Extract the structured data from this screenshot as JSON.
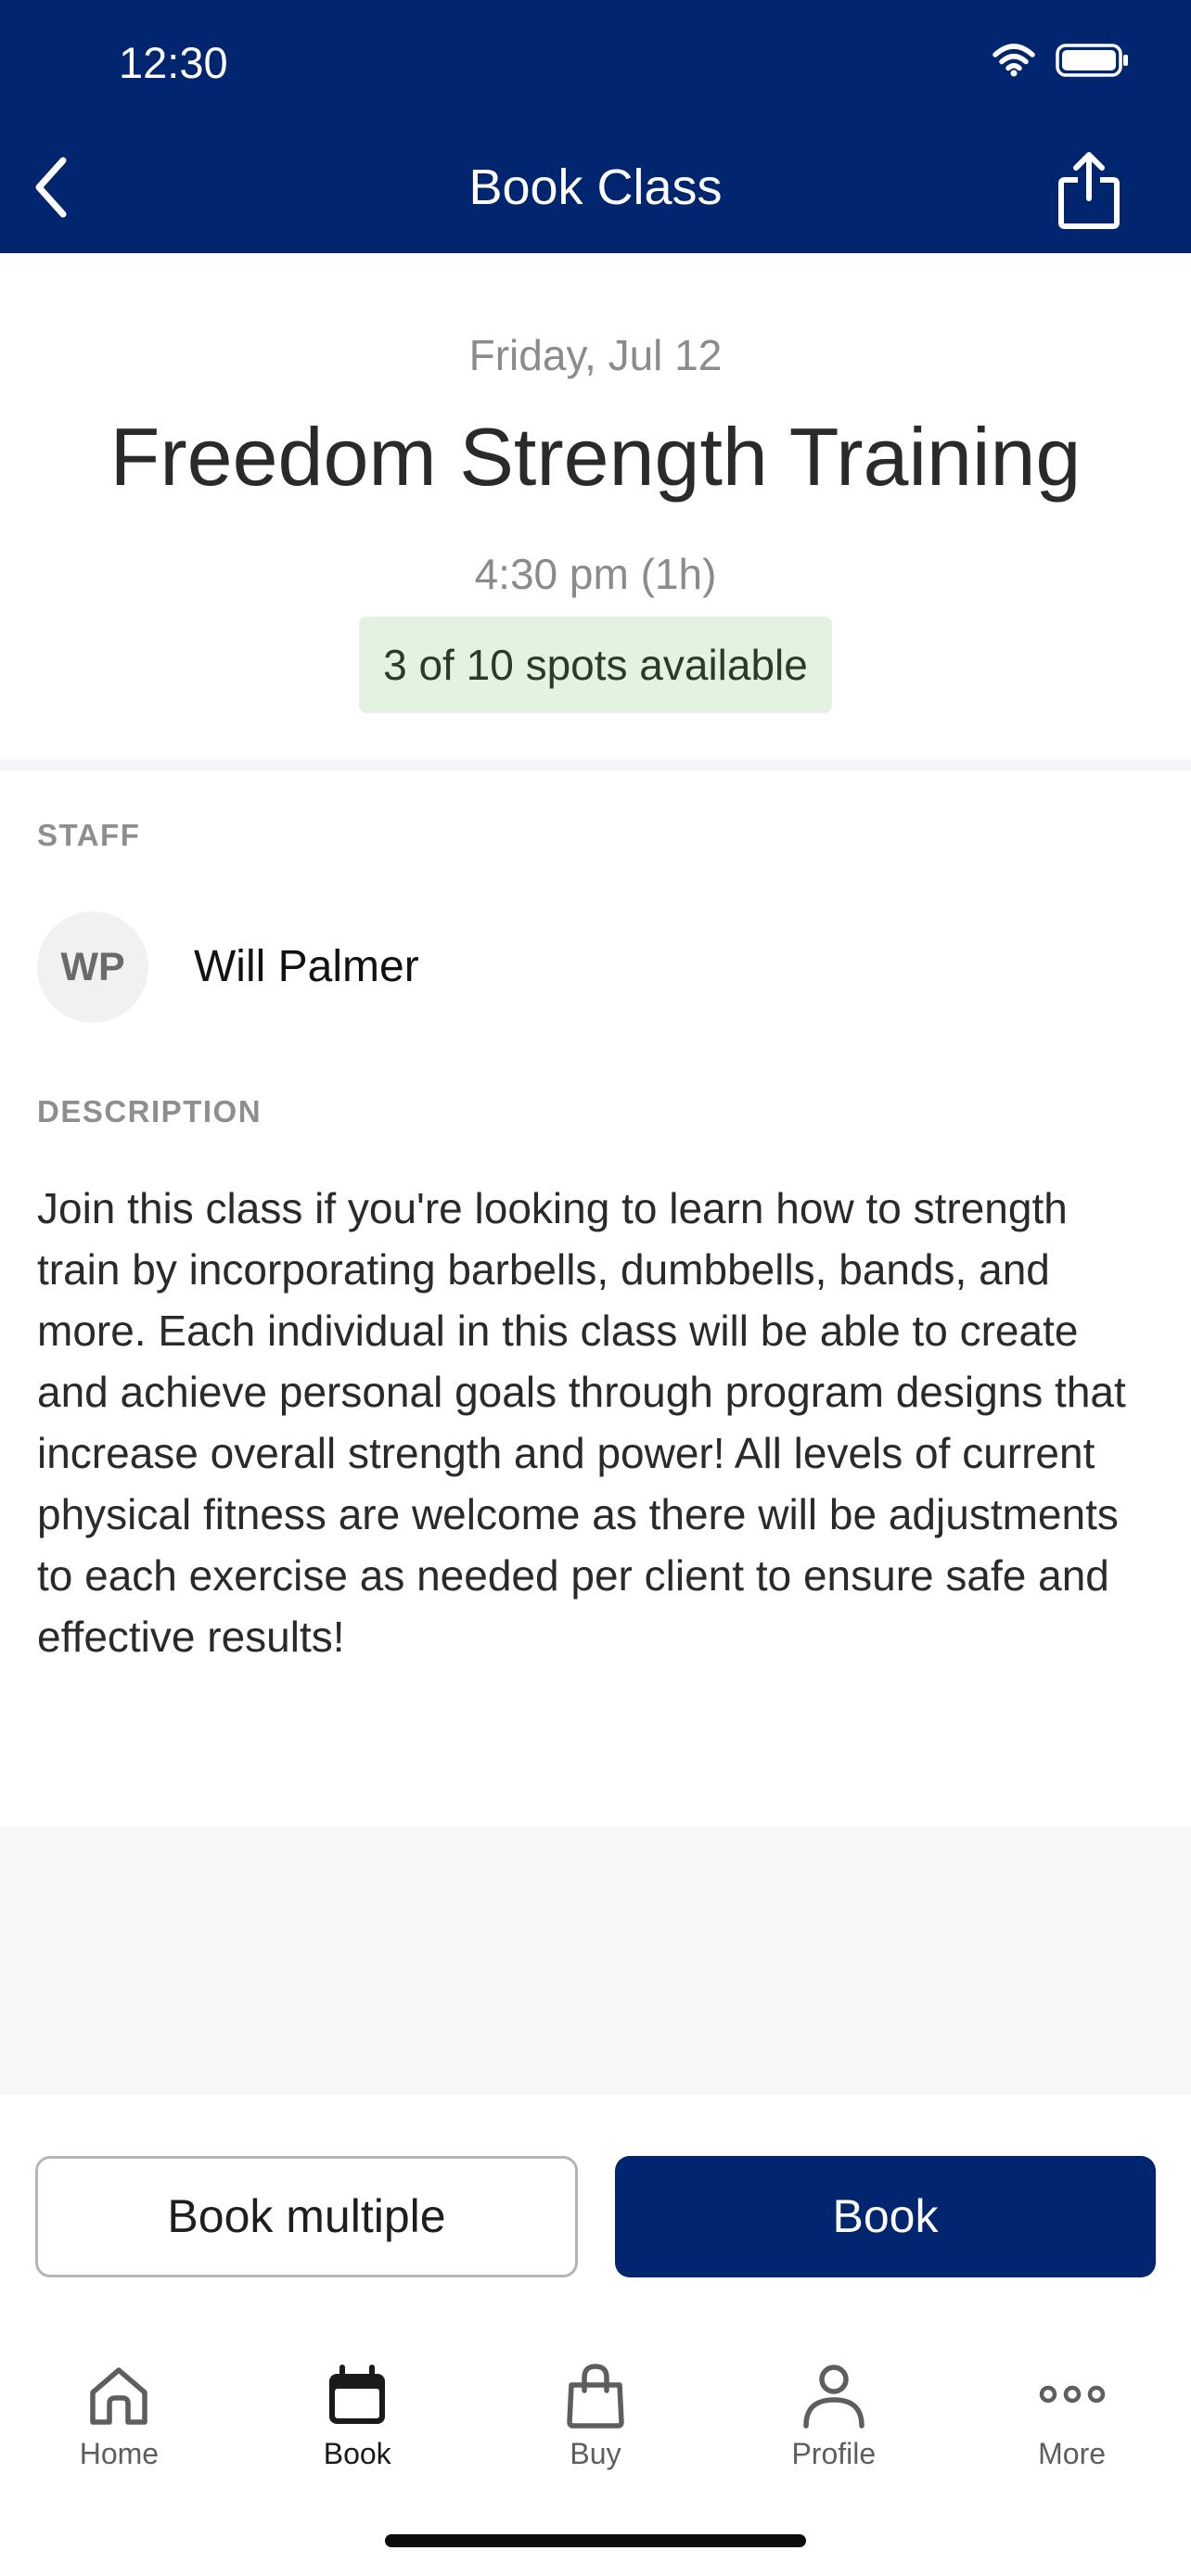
{
  "status_bar": {
    "time": "12:30"
  },
  "nav": {
    "title": "Book Class"
  },
  "class": {
    "date": "Friday, Jul 12",
    "title": "Freedom Strength Training",
    "time": "4:30 pm (1h)",
    "spots": "3 of 10 spots available"
  },
  "staff": {
    "label": "STAFF",
    "initials": "WP",
    "name": "Will Palmer"
  },
  "description": {
    "label": "DESCRIPTION",
    "text": "Join this class if you're looking to learn how to strength train by incorporating barbells, dumbbells, bands, and more. Each individual in this class will be able to create and achieve personal goals through program designs that increase overall strength and power! All levels of current physical fitness are welcome as there will be adjustments to each exercise as needed per client to ensure safe and effective results!"
  },
  "actions": {
    "book_multiple": "Book multiple",
    "book": "Book"
  },
  "tabbar": {
    "items": [
      {
        "label": "Home",
        "icon": "home-icon"
      },
      {
        "label": "Book",
        "icon": "calendar-icon"
      },
      {
        "label": "Buy",
        "icon": "shopping-bag-icon"
      },
      {
        "label": "Profile",
        "icon": "person-icon"
      },
      {
        "label": "More",
        "icon": "more-dots-icon"
      }
    ],
    "active": "Book"
  },
  "colors": {
    "brand": "#01256e",
    "spots_badge_bg": "#e3f2e1"
  }
}
